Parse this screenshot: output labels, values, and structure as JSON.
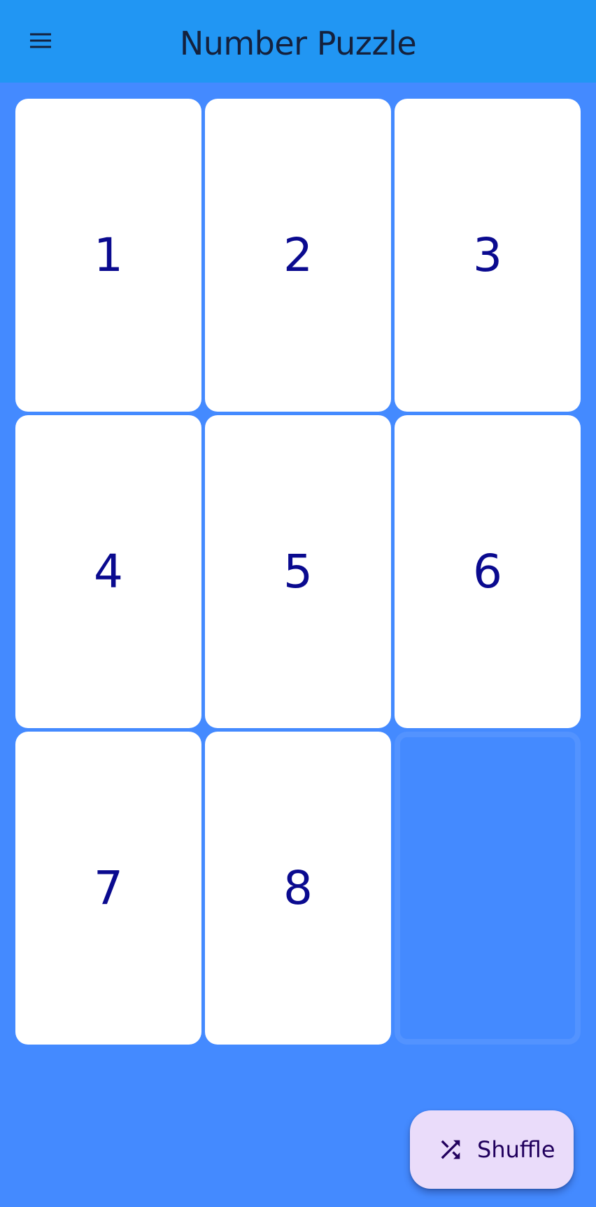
{
  "app_bar": {
    "title": "Number Puzzle",
    "menu_icon": "menu-icon"
  },
  "board": {
    "rows": 3,
    "columns": 3,
    "tiles": [
      {
        "label": "1",
        "empty": false
      },
      {
        "label": "2",
        "empty": false
      },
      {
        "label": "3",
        "empty": false
      },
      {
        "label": "4",
        "empty": false
      },
      {
        "label": "5",
        "empty": false
      },
      {
        "label": "6",
        "empty": false
      },
      {
        "label": "7",
        "empty": false
      },
      {
        "label": "8",
        "empty": false
      },
      {
        "label": "",
        "empty": true
      }
    ]
  },
  "fab": {
    "label": "Shuffle",
    "icon": "shuffle-icon"
  },
  "colors": {
    "app_bar": "#2196f3",
    "background": "#448aff",
    "tile": "#ffffff",
    "tile_number": "#0a0a8f",
    "title": "#14213d",
    "fab_background": "#eadcfa",
    "fab_foreground": "#21005d"
  }
}
